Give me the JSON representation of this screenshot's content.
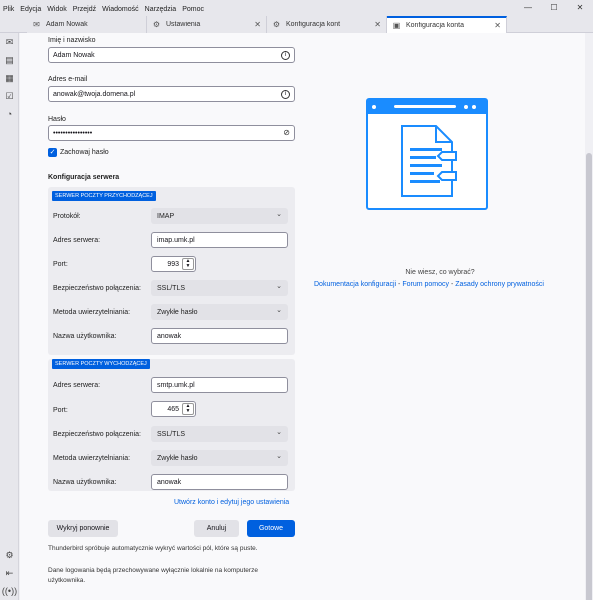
{
  "menubar": [
    "Plik",
    "Edycja",
    "Widok",
    "Przejdź",
    "Wiadomość",
    "Narzędzia",
    "Pomoc"
  ],
  "tabs": [
    {
      "label": "Adam Nowak",
      "icon": "mail-icon"
    },
    {
      "label": "Ustawienia",
      "icon": "gear-icon"
    },
    {
      "label": "Konfiguracja kont",
      "icon": "account-icon"
    },
    {
      "label": "Konfiguracja konta",
      "icon": "account-icon"
    }
  ],
  "form": {
    "name_label": "Imię i nazwisko",
    "name_value": "Adam Nowak",
    "email_label": "Adres e-mail",
    "email_value": "anowak@twoja.domena.pl",
    "password_label": "Hasło",
    "password_value": "••••••••••••••••",
    "remember_label": "Zachowaj hasło"
  },
  "server": {
    "title": "Konfiguracja serwera",
    "incoming_badge": "SERWER POCZTY PRZYCHODZĄCEJ",
    "outgoing_badge": "SERWER POCZTY WYCHODZĄCEJ",
    "protocol_label": "Protokół:",
    "protocol_value": "IMAP",
    "address_label": "Adres serwera:",
    "in_address": "imap.umk.pl",
    "out_address": "smtp.umk.pl",
    "port_label": "Port:",
    "in_port": "993",
    "out_port": "465",
    "security_label": "Bezpieczeństwo połączenia:",
    "in_security": "SSL/TLS",
    "out_security": "SSL/TLS",
    "auth_label": "Metoda uwierzytelniania:",
    "in_auth": "Zwykłe hasło",
    "out_auth": "Zwykłe hasło",
    "user_label": "Nazwa użytkownika:",
    "in_user": "anowak",
    "out_user": "anowak"
  },
  "actions": {
    "create_link": "Utwórz konto i edytuj jego ustawienia",
    "redetect": "Wykryj ponownie",
    "cancel": "Anuluj",
    "done": "Gotowe"
  },
  "notes": {
    "auto_detect": "Thunderbird spróbuje automatycznie wykryć wartości pól, które są puste.",
    "local_storage_1": "Dane logowania będą przechowywane wyłącznie lokalnie na komputerze",
    "local_storage_2": "użytkownika."
  },
  "help": {
    "question": "Nie wiesz, co wybrać?",
    "doc": "Dokumentacja konfiguracji",
    "forum": "Forum pomocy",
    "privacy": "Zasady ochrony prywatności",
    "sep": " - "
  },
  "colors": {
    "accent": "#0060df",
    "illustration": "#1a8cff"
  }
}
